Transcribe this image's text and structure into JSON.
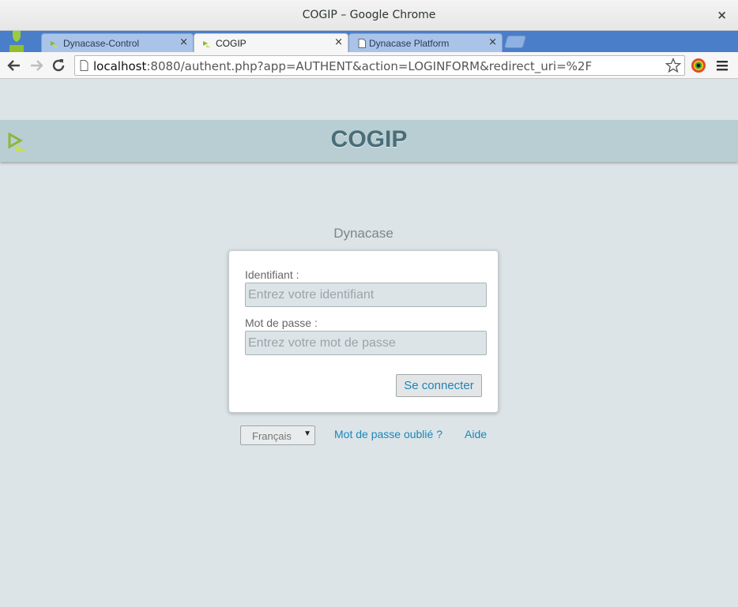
{
  "window": {
    "title": "COGIP – Google Chrome",
    "close_glyph": "×"
  },
  "tabs": [
    {
      "label": "Dynacase-Control",
      "close_glyph": "×",
      "icon": "dynacase-icon",
      "active": false
    },
    {
      "label": "COGIP",
      "close_glyph": "×",
      "icon": "dynacase-icon",
      "active": true
    },
    {
      "label": "Dynacase Platform",
      "close_glyph": "×",
      "icon": "page-icon",
      "active": false
    }
  ],
  "toolbar": {
    "url_host": "localhost",
    "url_rest": ":8080/authent.php?app=AUTHENT&action=LOGINFORM&redirect_uri=%2F"
  },
  "page": {
    "app_title": "COGIP",
    "product_name": "Dynacase",
    "login": {
      "username_label": "Identifiant :",
      "username_placeholder": "Entrez votre identifiant",
      "password_label": "Mot de passe :",
      "password_placeholder": "Entrez votre mot de passe",
      "submit_label": "Se connecter"
    },
    "footer": {
      "language_value": "Français",
      "forgot_password": "Mot de passe oublié ?",
      "help": "Aide"
    }
  },
  "colors": {
    "page_background": "#dce4e7",
    "header_band": "#b8ced3",
    "app_title": "#4a6d78",
    "link": "#1a86bb",
    "tabstrip": "#4a7ec8"
  }
}
